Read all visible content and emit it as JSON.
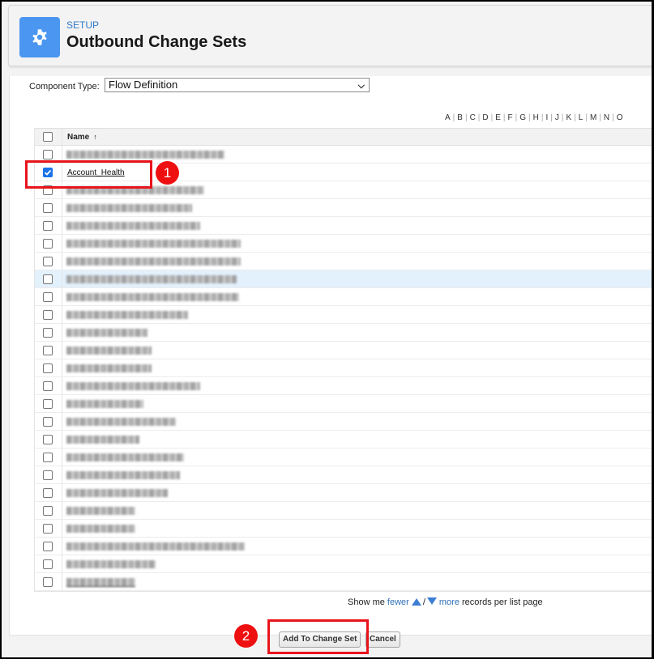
{
  "header": {
    "eyebrow": "SETUP",
    "title": "Outbound Change Sets",
    "icon": "gear-icon",
    "icon_color": "#4a96f0"
  },
  "filter": {
    "label": "Component Type:",
    "selected": "Flow Definition"
  },
  "alphabet": [
    "A",
    "B",
    "C",
    "D",
    "E",
    "F",
    "G",
    "H",
    "I",
    "J",
    "K",
    "L",
    "M",
    "N",
    "O"
  ],
  "table": {
    "columns": [
      {
        "label": "Name",
        "sort": "ascending"
      }
    ],
    "rows": [
      {
        "name": "[redacted]",
        "checked": false
      },
      {
        "name": "Account_Health",
        "checked": true
      },
      {
        "name": "[redacted]",
        "checked": false
      },
      {
        "name": "[redacted]",
        "checked": false
      },
      {
        "name": "[redacted]",
        "checked": false
      },
      {
        "name": "[redacted]",
        "checked": false
      },
      {
        "name": "[redacted]",
        "checked": false
      },
      {
        "name": "[redacted]",
        "checked": false,
        "hover": true
      },
      {
        "name": "[redacted]",
        "checked": false
      },
      {
        "name": "[redacted]",
        "checked": false
      },
      {
        "name": "[redacted]",
        "checked": false
      },
      {
        "name": "[redacted]",
        "checked": false
      },
      {
        "name": "[redacted]",
        "checked": false
      },
      {
        "name": "[redacted]",
        "checked": false
      },
      {
        "name": "[redacted]",
        "checked": false
      },
      {
        "name": "[redacted]",
        "checked": false
      },
      {
        "name": "[redacted]",
        "checked": false
      },
      {
        "name": "[redacted]",
        "checked": false
      },
      {
        "name": "[redacted]",
        "checked": false
      },
      {
        "name": "[redacted]",
        "checked": false
      },
      {
        "name": "[redacted]",
        "checked": false
      },
      {
        "name": "[redacted]",
        "checked": false
      },
      {
        "name": "[redacted]",
        "checked": false
      },
      {
        "name": "[redacted]",
        "checked": false
      },
      {
        "name": "[redacted]",
        "checked": false
      }
    ]
  },
  "pager": {
    "prefix": "Show me",
    "fewer": "fewer",
    "slash": "/",
    "more": "more",
    "suffix": "records per list page"
  },
  "buttons": {
    "add": "Add To Change Set",
    "cancel": "Cancel"
  },
  "annotations": {
    "step1": "1",
    "step2": "2",
    "color": "#e8141c"
  }
}
